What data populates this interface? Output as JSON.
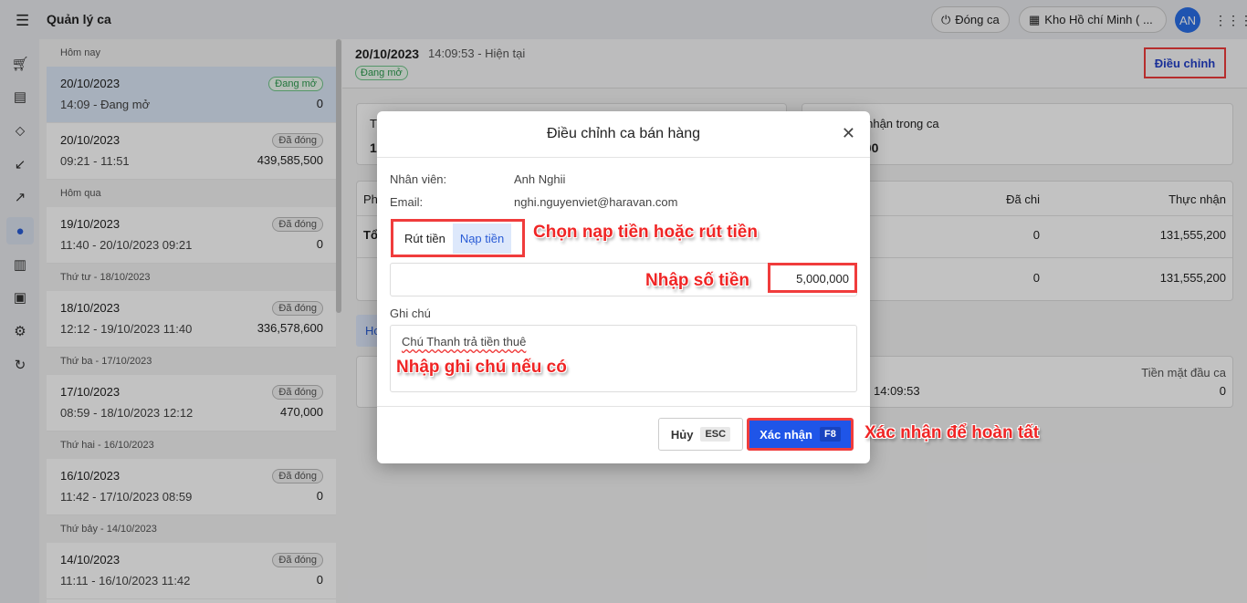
{
  "topbar": {
    "title": "Quản lý ca",
    "close_shift": "Đóng ca",
    "store": "Kho Hồ chí Minh ( ...",
    "avatar": "AN"
  },
  "list": {
    "groups": [
      {
        "header": "Hôm nay",
        "items": [
          {
            "date": "20/10/2023",
            "time": "14:09 - Đang mở",
            "amount": "0",
            "status": "Đang mở"
          },
          {
            "date": "20/10/2023",
            "time": "09:21 - 11:51",
            "amount": "439,585,500",
            "status": "Đã đóng"
          }
        ]
      },
      {
        "header": "Hôm qua",
        "items": [
          {
            "date": "19/10/2023",
            "time": "11:40 - 20/10/2023 09:21",
            "amount": "0",
            "status": "Đã đóng"
          }
        ]
      },
      {
        "header": "Thứ tư - 18/10/2023",
        "items": [
          {
            "date": "18/10/2023",
            "time": "12:12 - 19/10/2023 11:40",
            "amount": "336,578,600",
            "status": "Đã đóng"
          }
        ]
      },
      {
        "header": "Thứ ba - 17/10/2023",
        "items": [
          {
            "date": "17/10/2023",
            "time": "08:59 - 18/10/2023 12:12",
            "amount": "470,000",
            "status": "Đã đóng"
          }
        ]
      },
      {
        "header": "Thứ hai - 16/10/2023",
        "items": [
          {
            "date": "16/10/2023",
            "time": "11:42 - 17/10/2023 08:59",
            "amount": "0",
            "status": "Đã đóng"
          }
        ]
      },
      {
        "header": "Thứ bảy - 14/10/2023",
        "items": [
          {
            "date": "14/10/2023",
            "time": "11:11 - 16/10/2023 11:42",
            "amount": "0",
            "status": "Đã đóng"
          }
        ]
      }
    ]
  },
  "main": {
    "date": "20/10/2023",
    "time": "14:09:53 - Hiện tại",
    "status": "Đang mở",
    "adjust": "Điều chỉnh",
    "card1": {
      "label_partial": "T",
      "value_partial": "1"
    },
    "card2": {
      "label_partial": "c nhận trong ca",
      "value_partial": "200"
    },
    "table": {
      "col_partial": "Ph",
      "col_spent": "Đã chi",
      "col_received": "Thực nhận",
      "row1_partial": "Tổ",
      "rows": [
        {
          "spent": "0",
          "received": "131,555,200"
        },
        {
          "spent": "0",
          "received": "131,555,200"
        }
      ]
    },
    "tab_partial": "Ho",
    "shift": {
      "time": "14:09:53",
      "cash_label": "Tiền mặt đầu ca",
      "cash": "0"
    }
  },
  "modal": {
    "title": "Điều chỉnh ca bán hàng",
    "employee_label": "Nhân viên:",
    "employee": "Anh Nghii",
    "email_label": "Email:",
    "email": "nghi.nguyenviet@haravan.com",
    "withdraw": "Rút tiền",
    "deposit": "Nạp tiền",
    "amount": "5,000,000",
    "note_label": "Ghi chú",
    "note": "Chú Thanh trả tiền thuê",
    "cancel": "Hủy",
    "cancel_key": "ESC",
    "confirm": "Xác nhận",
    "confirm_key": "F8"
  },
  "annotations": {
    "choose": "Chọn nạp tiền hoặc rút tiền",
    "amount": "Nhập số tiền",
    "note": "Nhập ghi chú nếu có",
    "confirm": "Xác nhận để hoàn tất"
  },
  "colors": {
    "accent": "#2a5cd6",
    "annotation": "#f02525",
    "confirm": "#1f55e8"
  }
}
